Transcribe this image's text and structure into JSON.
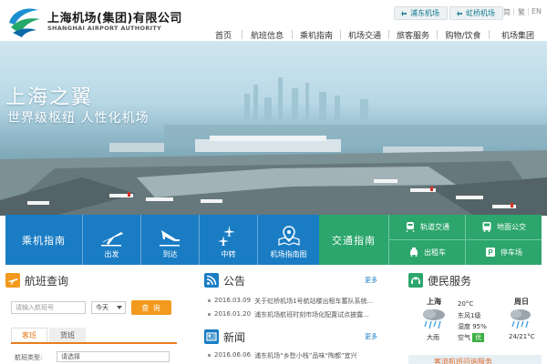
{
  "header": {
    "logo_cn": "上海机场(集团)有限公司",
    "logo_en": "SHANGHAI AIRPORT AUTHORITY",
    "airport_tabs": [
      "浦东机场",
      "虹桥机场"
    ],
    "lang_simplified": "简",
    "lang_traditional": "繁",
    "lang_english": "EN"
  },
  "nav": {
    "items": [
      "首页",
      "航班信息",
      "乘机指南",
      "机场交通",
      "旅客服务",
      "购物/饮食",
      "机场集团"
    ]
  },
  "banner": {
    "title": "上海之翼",
    "subtitle": "世界级枢纽 人性化机场"
  },
  "quick": {
    "guide_title": "乘机指南",
    "guide_items": [
      "出发",
      "到达",
      "中转",
      "机场指南图"
    ],
    "traffic_title": "交通指南",
    "traffic_items": [
      "轨道交通",
      "地面公交",
      "出租车",
      "停车场"
    ]
  },
  "flight": {
    "title": "航班查询",
    "input_placeholder": "请输入航班号",
    "day": "今天",
    "query_label": "查 询",
    "tabs": [
      "客班",
      "货班"
    ],
    "type_label": "航班类型:",
    "type_value": "请选择"
  },
  "notice": {
    "title": "公告",
    "more": "更多",
    "items": [
      {
        "date": "2016.03.09",
        "text": "关于虹桥机场1号航站楼出租车蓄队系统..."
      },
      {
        "date": "2016.01.20",
        "text": "浦东机场航班时刻市场化配置试点披露..."
      }
    ]
  },
  "news": {
    "title": "新闻",
    "more": "更多",
    "items": [
      {
        "date": "2016.06.06",
        "text": "浦东机场“乡愁小栈”品味“陶都”宜兴"
      }
    ]
  },
  "service": {
    "title": "便民服务",
    "city": "上海",
    "condition": "大雨",
    "temp": "20°C",
    "wind": "东风1级",
    "humidity": "湿度 95%",
    "air_label": "空气",
    "air_value": "优",
    "forecast_day": "周日",
    "forecast_temp": "24/21°C",
    "strip_text": "客流航班问询服务"
  },
  "colors": {
    "blue": "#1a7dc4",
    "green": "#2ca66c",
    "orange": "#f39a1e",
    "teal": "#0a7a8c"
  }
}
